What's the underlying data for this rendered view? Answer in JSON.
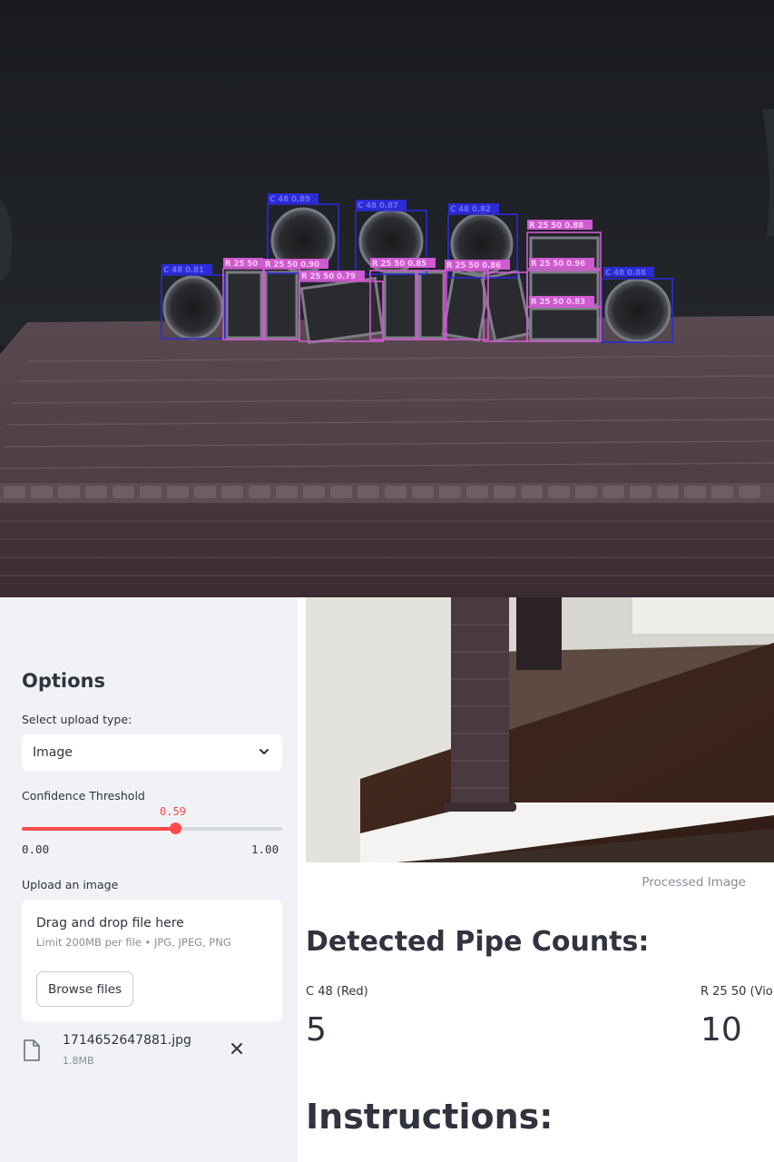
{
  "processed_image": {
    "caption": "Processed Image",
    "detections": [
      {
        "label": "C 48 0.81",
        "cls": "C"
      },
      {
        "label": "C 48 0.89",
        "cls": "C"
      },
      {
        "label": "C 48 0.87",
        "cls": "C"
      },
      {
        "label": "C 48 0.82",
        "cls": "C"
      },
      {
        "label": "C 48 0.88",
        "cls": "C"
      },
      {
        "label": "R 25 50 0.88",
        "cls": "R"
      },
      {
        "label": "R 25 50 0.96",
        "cls": "R"
      },
      {
        "label": "R 25 50 0.83",
        "cls": "R"
      },
      {
        "label": "R 25 50 0.90",
        "cls": "R"
      },
      {
        "label": "R 25 50 0.79",
        "cls": "R"
      },
      {
        "label": "R 25 50 0.85",
        "cls": "R"
      },
      {
        "label": "R 25 50 0.86",
        "cls": "R"
      },
      {
        "label": "R 25 50 0.85",
        "cls": "R"
      },
      {
        "label": "R 25 50",
        "cls": "R"
      },
      {
        "label": "R 25 50",
        "cls": "R"
      }
    ]
  },
  "sidebar": {
    "title": "Options",
    "upload_type_label": "Select upload type:",
    "upload_type_value": "Image",
    "confidence_label": "Confidence Threshold",
    "confidence_value": 0.59,
    "confidence_value_text": "0.59",
    "confidence_min": "0.00",
    "confidence_max": "1.00",
    "upload_label": "Upload an image",
    "dropzone_title": "Drag and drop file here",
    "dropzone_limit": "Limit 200MB per file • JPG, JPEG, PNG",
    "browse_label": "Browse files",
    "file_name": "1714652647881.jpg",
    "file_size": "1.8MB"
  },
  "main": {
    "counts_heading": "Detected Pipe Counts:",
    "metrics": [
      {
        "label": "C 48 (Red)",
        "value": "5"
      },
      {
        "label": "R 25 50 (Vio",
        "value": "10"
      }
    ],
    "instructions_heading": "Instructions:"
  },
  "colors": {
    "accent": "#ff4b4b",
    "sidebar_bg": "#f0f2f6",
    "circle_box": "#2b2bd8",
    "rect_box": "#d05ad0"
  }
}
